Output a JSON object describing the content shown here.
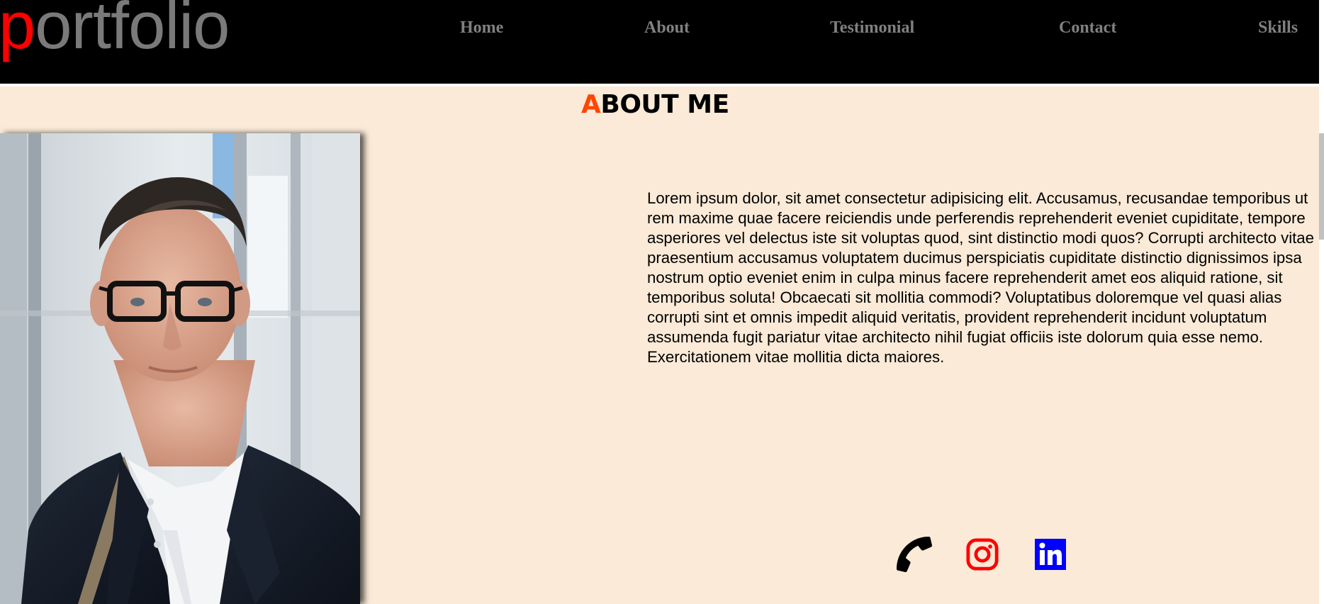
{
  "header": {
    "logo_first": "p",
    "logo_rest": "ortfolio",
    "nav": [
      "Home",
      "About",
      "Testimonial",
      "Contact",
      "Skills"
    ]
  },
  "about": {
    "title_first": "A",
    "title_rest": "BOUT ME",
    "bio": "Lorem ipsum dolor, sit amet consectetur adipisicing elit. Accusamus, recusandae temporibus ut rem maxime quae facere reiciendis unde perferendis reprehenderit eveniet cupiditate, tempore asperiores vel delectus iste sit voluptas quod, sint distinctio modi quos? Corrupti architecto vitae praesentium accusamus voluptatem ducimus perspiciatis cupiditate distinctio dignissimos ipsa nostrum optio eveniet enim in culpa minus facere reprehenderit amet eos aliquid ratione, sit temporibus soluta! Obcaecati sit mollitia commodi? Voluptatibus doloremque vel quasi alias corrupti sint et omnis impedit aliquid veritatis, provident reprehenderit incidunt voluptatum assumenda fugit pariatur vitae architecto nihil fugiat officiis iste dolorum quia esse nemo. Exercitationem vitae mollitia dicta maiores."
  },
  "social": {
    "icons": [
      "phone-icon",
      "instagram-icon",
      "linkedin-icon"
    ]
  },
  "colors": {
    "header_bg": "#000000",
    "nav_text": "#808080",
    "logo_accent": "#ff0000",
    "logo_text": "#7a7a7a",
    "section_bg": "#faead7",
    "title_accent": "#ff4500",
    "instagram": "#ff0000",
    "linkedin": "#0000ff"
  }
}
